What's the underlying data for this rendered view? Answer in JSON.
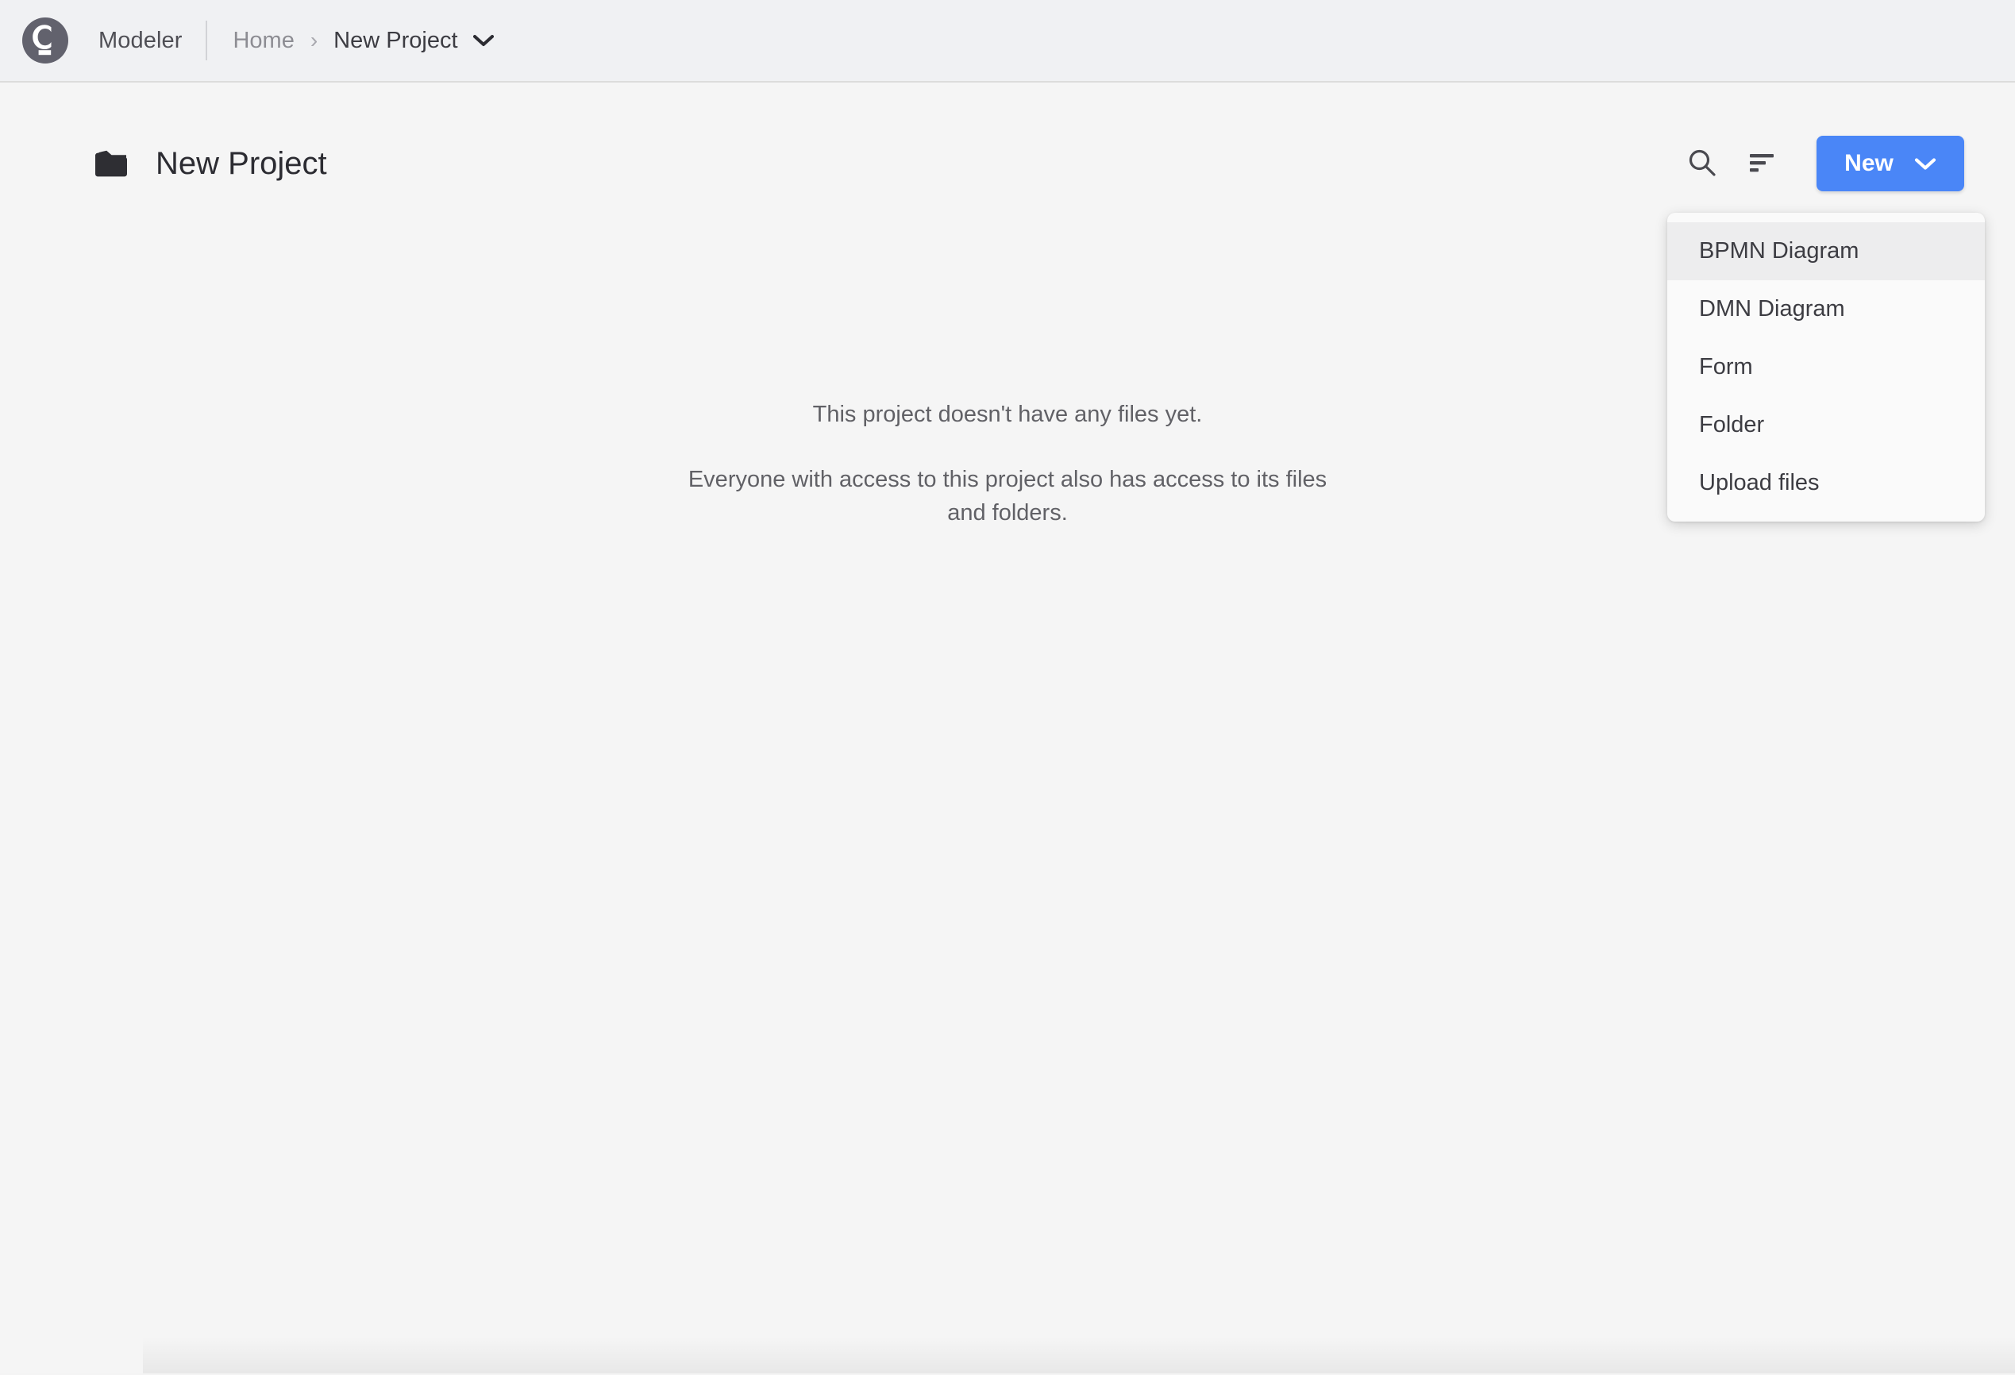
{
  "topbar": {
    "logo_icon": "camunda-logo-icon",
    "brand_name": "Modeler",
    "breadcrumb": {
      "home_label": "Home",
      "separator": "›",
      "current_label": "New Project",
      "chevron_icon": "chevron-down-icon"
    }
  },
  "page": {
    "folder_icon": "folder-icon",
    "title": "New Project",
    "actions": {
      "search_icon": "search-icon",
      "sort_icon": "sort-icon",
      "new_button_label": "New",
      "new_button_chevron_icon": "chevron-down-icon"
    }
  },
  "dropdown": {
    "visible": true,
    "items": [
      {
        "label": "BPMN Diagram",
        "highlighted": true
      },
      {
        "label": "DMN Diagram",
        "highlighted": false
      },
      {
        "label": "Form",
        "highlighted": false
      },
      {
        "label": "Folder",
        "highlighted": false
      },
      {
        "label": "Upload files",
        "highlighted": false
      }
    ]
  },
  "empty_state": {
    "line_1": "This project doesn't have any files yet.",
    "line_2": "Everyone with access to this project also has access to its files and folders."
  },
  "colors": {
    "accent_blue": "#4a86f7",
    "topbar_background": "#f0f1f3",
    "content_background": "#f5f5f5",
    "menu_background": "#fafafa",
    "menu_highlight": "#ededee",
    "logo_background": "#62626d",
    "text_primary": "#2c2c32",
    "text_muted": "#8d8d93"
  }
}
